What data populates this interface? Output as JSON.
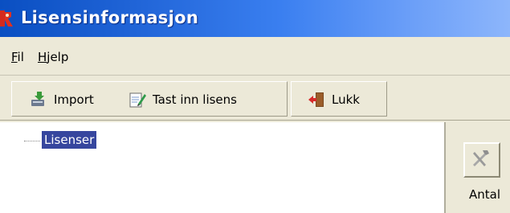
{
  "window": {
    "title": "Lisensinformasjon"
  },
  "menu": {
    "items": [
      "Fil",
      "Hjelp"
    ]
  },
  "toolbar": {
    "import_label": "Import",
    "enter_license_label": "Tast inn lisens",
    "close_label": "Lukk"
  },
  "tree": {
    "root_label": "Lisenser"
  },
  "side_panel": {
    "label": "Antal"
  },
  "icons": {
    "app": "red-app-icon",
    "import": "import-icon",
    "enter_license": "edit-license-icon",
    "close": "exit-door-icon",
    "tools": "tools-icon"
  },
  "colors": {
    "title_bar": "#0a4fc2",
    "selection": "#36469e",
    "window_bg": "#ece9d8"
  }
}
